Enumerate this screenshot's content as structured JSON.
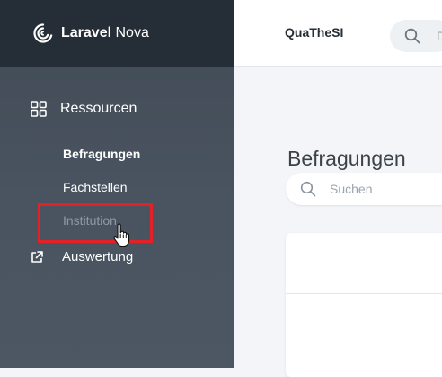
{
  "brand": {
    "name_bold": "Laravel",
    "name_light": " Nova",
    "logo_icon": "laravel-nova-logo"
  },
  "sidebar": {
    "section_label": "Ressourcen",
    "section_icon": "grid-icon",
    "items": [
      {
        "label": "Befragungen",
        "active": true
      },
      {
        "label": "Fachstellen",
        "active": false
      },
      {
        "label": "Institution",
        "active": false,
        "hovered": true
      }
    ],
    "external_link": {
      "label": "Auswertung",
      "icon": "external-link-icon"
    }
  },
  "topbar": {
    "app_name": "QuaTheSI",
    "search_cut_text": "D"
  },
  "main": {
    "title": "Befragungen",
    "search_placeholder": "Suchen"
  },
  "colors": {
    "highlight": "#e32127",
    "sidebar_dark": "#252d36",
    "sidebar": "#4a5460"
  }
}
